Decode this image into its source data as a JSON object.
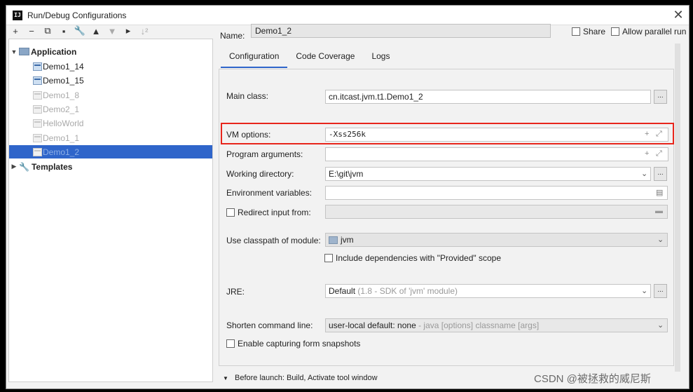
{
  "window": {
    "title": "Run/Debug Configurations",
    "app_icon": "IJ"
  },
  "toolbar": {
    "add": "+",
    "remove": "−",
    "copy": "⧉",
    "save": "▪",
    "edit": "🔧",
    "up": "▲",
    "down": "▼",
    "folder": "▸",
    "sort": "↓²"
  },
  "tree": {
    "root_label": "Application",
    "items": [
      {
        "label": "Demo1_14",
        "faded": false
      },
      {
        "label": "Demo1_15",
        "faded": false
      },
      {
        "label": "Demo1_8",
        "faded": true
      },
      {
        "label": "Demo2_1",
        "faded": true
      },
      {
        "label": "HelloWorld",
        "faded": true
      },
      {
        "label": "Demo1_1",
        "faded": true
      },
      {
        "label": "Demo1_2",
        "faded": true,
        "selected": true
      }
    ],
    "templates_label": "Templates"
  },
  "header": {
    "name_label": "Name:",
    "name_value": "Demo1_2",
    "share_label": "Share",
    "parallel_label": "Allow parallel run"
  },
  "tabs": [
    "Configuration",
    "Code Coverage",
    "Logs"
  ],
  "form": {
    "main_class_label": "Main class:",
    "main_class_value": "cn.itcast.jvm.t1.Demo1_2",
    "vm_options_label": "VM options:",
    "vm_options_value": "-Xss256k",
    "program_args_label": "Program arguments:",
    "working_dir_label": "Working directory:",
    "working_dir_value": "E:\\git\\jvm",
    "env_vars_label": "Environment variables:",
    "redirect_label": "Redirect input from:",
    "classpath_label": "Use classpath of module:",
    "classpath_value": "jvm",
    "include_deps_label": "Include dependencies with \"Provided\" scope",
    "jre_label": "JRE:",
    "jre_value": "Default",
    "jre_hint": "(1.8 - SDK of 'jvm' module)",
    "shorten_label": "Shorten command line:",
    "shorten_value": "user-local default: none",
    "shorten_hint": "- java [options] classname [args]",
    "snapshots_label": "Enable capturing form snapshots",
    "dots": "...",
    "expand_plus": "+",
    "expand_arrows": "⤢"
  },
  "footer": {
    "before_launch": "Before launch: Build, Activate tool window"
  },
  "watermark": "CSDN @被拯救的威尼斯",
  "colors": {
    "selection": "#2f65ca",
    "highlight_border": "#e8261c"
  }
}
